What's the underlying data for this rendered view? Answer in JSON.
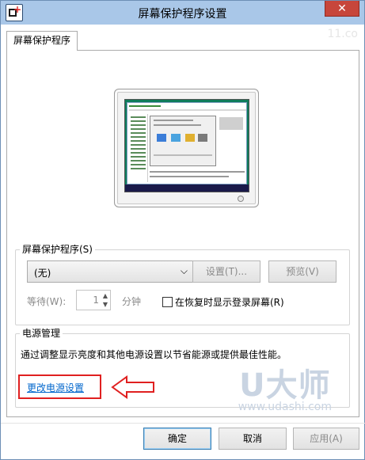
{
  "window": {
    "title": "屏幕保护程序设置",
    "close_glyph": "✕",
    "app_icon_plus": "+"
  },
  "tabs": [
    {
      "label": "屏幕保护程序"
    }
  ],
  "screensaver_group": {
    "label": "屏幕保护程序(S)",
    "selected_value": "(无)",
    "settings_button": "设置(T)...",
    "preview_button": "预览(V)",
    "wait_label": "等待(W):",
    "wait_value": "1",
    "wait_unit": "分钟",
    "resume_checkbox_label": "在恢复时显示登录屏幕(R)",
    "resume_checked": false
  },
  "power_group": {
    "label": "电源管理",
    "description": "通过调整显示亮度和其他电源设置以节省能源或提供最佳性能。",
    "link": "更改电源设置"
  },
  "footer": {
    "ok": "确定",
    "cancel": "取消",
    "apply": "应用(A)"
  },
  "watermark": {
    "logo": "U大师",
    "url": "www.udashi.com",
    "top_mark": "11.co"
  },
  "colors": {
    "titlebar": "#a9c7e8",
    "close": "#c7463b",
    "link": "#0066cc",
    "highlight_frame": "#e02020"
  },
  "icons": [
    "app-icon",
    "close-icon",
    "chevron-down-icon",
    "spin-up-icon",
    "spin-down-icon",
    "arrow-left-icon"
  ]
}
